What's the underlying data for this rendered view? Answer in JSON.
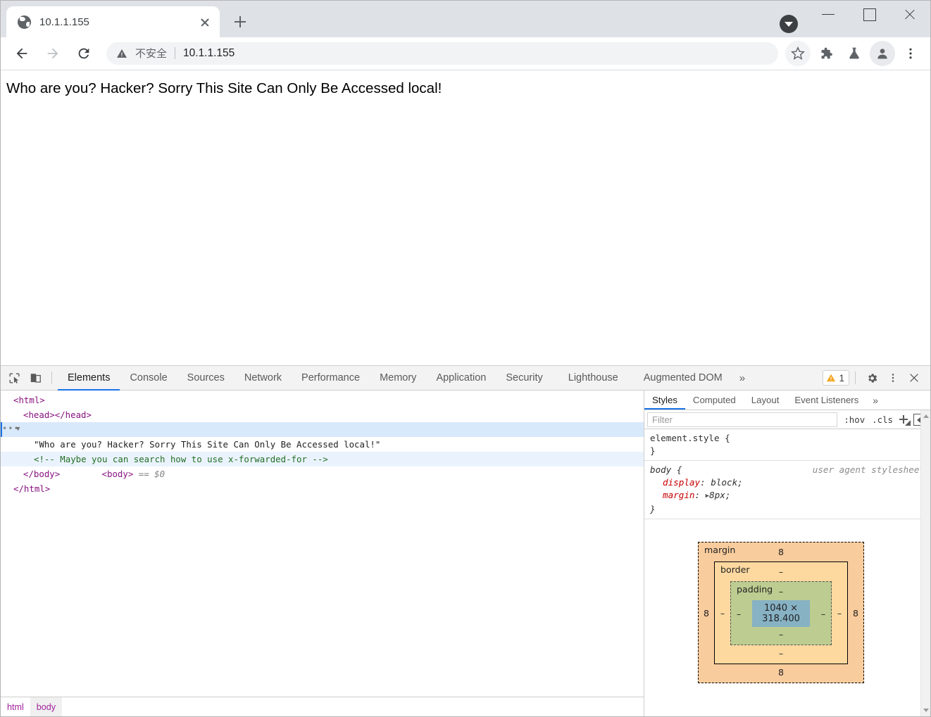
{
  "browser": {
    "tab": {
      "title": "10.1.1.155",
      "favicon": "globe-icon",
      "close": "×"
    },
    "newtab_label": "+",
    "window_controls": {
      "minimize": "—",
      "maximize": "□",
      "close": "✕"
    },
    "download_indicator": "download-icon",
    "toolbar": {
      "back": "back-arrow-icon",
      "forward": "forward-arrow-icon",
      "reload": "reload-icon",
      "security_label": "不安全",
      "security_icon": "warning-triangle-icon",
      "separator": "|",
      "url": "10.1.1.155",
      "bookmark": "star-icon",
      "extensions": "puzzle-icon",
      "lab": "flask-icon",
      "profile": "avatar-icon",
      "menu": "three-dot-menu-icon"
    }
  },
  "page": {
    "body_text": "Who are you? Hacker? Sorry This Site Can Only Be Accessed local!"
  },
  "devtools": {
    "tools": {
      "inspect": "inspect-element-icon",
      "device": "device-toolbar-icon"
    },
    "tabs": [
      {
        "label": "Elements",
        "active": true
      },
      {
        "label": "Console",
        "active": false
      },
      {
        "label": "Sources",
        "active": false
      },
      {
        "label": "Network",
        "active": false
      },
      {
        "label": "Performance",
        "active": false
      },
      {
        "label": "Memory",
        "active": false
      },
      {
        "label": "Application",
        "active": false
      },
      {
        "label": "Security",
        "active": false
      },
      {
        "label": "Lighthouse",
        "active": false
      },
      {
        "label": "Augmented DOM",
        "active": false
      }
    ],
    "more_tabs": "»",
    "warning_count": "1",
    "warning_icon": "warning-triangle-icon",
    "settings_icon": "gear-icon",
    "kebab_icon": "three-dot-menu-icon",
    "close_icon": "close-icon",
    "dom": {
      "lines": [
        {
          "text": "<html>",
          "indent": 0,
          "state": ""
        },
        {
          "text": "<head></head>",
          "indent": 1,
          "state": ""
        },
        {
          "text": "<body> == $0",
          "indent": 1,
          "state": "selected"
        },
        {
          "text": "\"Who are you? Hacker? Sorry This Site Can Only Be Accessed local!\"",
          "indent": 2,
          "state": ""
        },
        {
          "text": "<!-- Maybe you can search how to use x-forwarded-for -->",
          "indent": 2,
          "state": "highlight"
        },
        {
          "text": "</body>",
          "indent": 1,
          "state": ""
        },
        {
          "text": "</html>",
          "indent": 0,
          "state": ""
        }
      ],
      "html_tag": "html",
      "head_tag": "head",
      "body_tag": "body",
      "body_marker": "== $0",
      "text_node": "\"Who are you? Hacker? Sorry This Site Can Only Be Accessed local!\"",
      "comment_node": "<!-- Maybe you can search how to use x-forwarded-for -->"
    },
    "breadcrumbs": [
      {
        "label": "html",
        "active": false
      },
      {
        "label": "body",
        "active": true
      }
    ],
    "sidebar": {
      "tabs": [
        {
          "label": "Styles",
          "active": true
        },
        {
          "label": "Computed",
          "active": false
        },
        {
          "label": "Layout",
          "active": false
        },
        {
          "label": "Event Listeners",
          "active": false
        }
      ],
      "more_tabs": "»",
      "filter_placeholder": "Filter",
      "filter_value": "",
      "hov_label": ":hov",
      "cls_label": ".cls",
      "new_rule_icon": "plus-icon",
      "toggle_sidebar_icon": "toggle-sidebar-icon",
      "rules": [
        {
          "selector": "element.style {",
          "close": "}",
          "origin": "",
          "declarations": []
        },
        {
          "selector": "body {",
          "close": "}",
          "origin": "user agent stylesheet",
          "declarations": [
            {
              "name": "display",
              "value": "block;",
              "expandable": false
            },
            {
              "name": "margin",
              "value": "8px;",
              "expandable": true
            }
          ]
        }
      ],
      "box_model": {
        "margin_label": "margin",
        "margin_top": "8",
        "margin_right": "8",
        "margin_bottom": "8",
        "margin_left": "8",
        "border_label": "border",
        "border_top": "–",
        "border_right": "–",
        "border_bottom": "–",
        "border_left": "–",
        "padding_label": "padding",
        "padding_top": "–",
        "padding_right": "–",
        "padding_bottom": "–",
        "padding_left": "–",
        "content": "1040 × 318.400"
      }
    }
  },
  "colors": {
    "accent": "#1a73e8",
    "tabstrip": "#dee1e6",
    "omnibox": "#f1f3f4",
    "selection": "#d8e9fb",
    "margin_box": "#f9cc9d",
    "border_box": "#fdd9a0",
    "padding_box": "#bdcc90",
    "content_box": "#87b2c4",
    "tag_purple": "#881280",
    "comment_green": "#236e25",
    "prop_red": "#c80000"
  }
}
